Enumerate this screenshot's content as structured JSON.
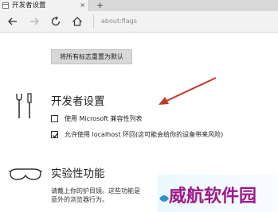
{
  "tab": {
    "title": "开发者设置",
    "close_glyph": "×"
  },
  "newtab_glyph": "+",
  "address": {
    "url": "about:flags"
  },
  "reset_button_label": "将所有标志重置为默认",
  "developer_section": {
    "title": "开发者设置",
    "options": [
      {
        "label": "使用 Microsoft 兼容性列表",
        "checked": false
      },
      {
        "label": "允许使用 localhost 环回(这可能会给你的设备带来风险)",
        "checked": true
      }
    ]
  },
  "experimental_section": {
    "title": "实验性功能",
    "desc_lines": [
      "请戴上你的护目镜。这些功能是",
      "意外的浏览器行为。"
    ]
  },
  "watermark": {
    "text": "威航软件园"
  },
  "icons": {
    "back": "arrow-left-icon",
    "forward": "arrow-right-icon",
    "refresh": "refresh-icon",
    "home": "home-icon",
    "dev_tools": "tools-icon",
    "experimental": "goggles-icon"
  },
  "colors": {
    "annotation_arrow": "#c0392b",
    "watermark": "#a0188a"
  }
}
